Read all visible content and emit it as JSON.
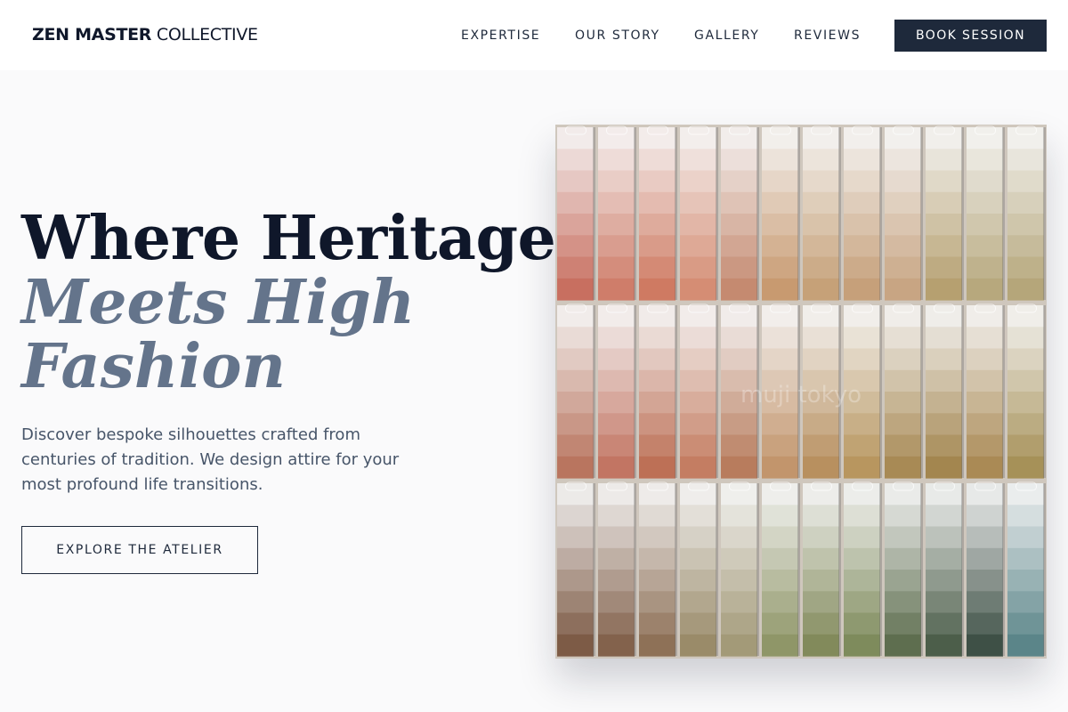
{
  "brand": {
    "bold": "ZEN MASTER",
    "light": "COLLECTIVE"
  },
  "nav": {
    "items": [
      "EXPERTISE",
      "OUR STORY",
      "GALLERY",
      "REVIEWS"
    ],
    "cta": "BOOK SESSION"
  },
  "hero": {
    "title_line1": "Where Heritage",
    "title_line2": "Meets High Fashion",
    "description": "Discover bespoke silhouettes crafted from centuries of tradition. We design attire for your most profound life transitions.",
    "cta": "EXPLORE THE ATELIER"
  },
  "image": {
    "watermark": "muji tokyo",
    "palette_rows": [
      [
        "#c86f60",
        "#cf7d6a",
        "#cf7a62",
        "#d58d74",
        "#c58a70",
        "#c89a70",
        "#c6a178",
        "#c6a07a",
        "#c8a583",
        "#b6a070",
        "#b7a87d",
        "#b5a67a"
      ],
      [
        "#b9755f",
        "#c27563",
        "#bd7056",
        "#c47d62",
        "#b87c5d",
        "#c2956c",
        "#b8905f",
        "#b8965f",
        "#a88a55",
        "#a3864f",
        "#aa8a55",
        "#a69158"
      ],
      [
        "#7d5b46",
        "#83624c",
        "#8e7157",
        "#9a8b69",
        "#a39a78",
        "#8f9668",
        "#828a5b",
        "#7e8b5c",
        "#5e6e4f",
        "#4c5e4a",
        "#3e5046",
        "#5b8589"
      ]
    ]
  }
}
